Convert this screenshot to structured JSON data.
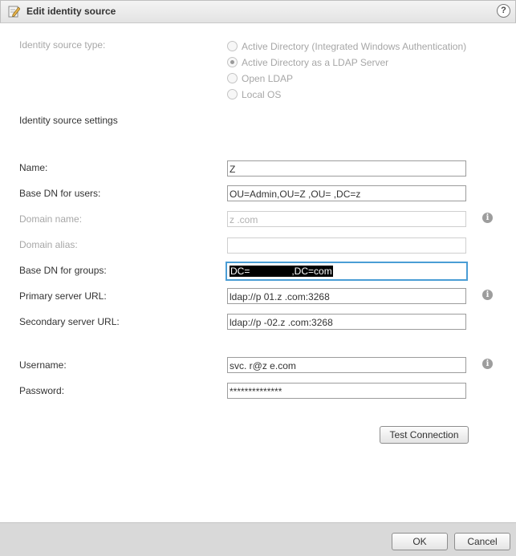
{
  "dialog": {
    "title": "Edit identity source",
    "help": "?"
  },
  "identity_type": {
    "label": "Identity source type:",
    "options": [
      {
        "label": "Active Directory (Integrated Windows Authentication)",
        "selected": false
      },
      {
        "label": "Active Directory as a LDAP Server",
        "selected": true
      },
      {
        "label": "Open LDAP",
        "selected": false
      },
      {
        "label": "Local OS",
        "selected": false
      }
    ]
  },
  "settings_heading": "Identity source settings",
  "fields": {
    "name": {
      "label": "Name:",
      "value": "Z"
    },
    "base_dn_users": {
      "label": "Base DN for users:",
      "value": "OU=Admin,OU=Z        ,OU=              ,DC=z"
    },
    "domain_name": {
      "label": "Domain name:",
      "value": "z          .com"
    },
    "domain_alias": {
      "label": "Domain alias:",
      "value": ""
    },
    "base_dn_groups": {
      "label": "Base DN for groups:",
      "value_prefix": "DC=",
      "value_suffix": ",DC=com"
    },
    "primary_url": {
      "label": "Primary server URL:",
      "value": "ldap://p            01.z              .com:3268"
    },
    "secondary_url": {
      "label": "Secondary server URL:",
      "value": "ldap://p          -02.z            .com:3268"
    },
    "username": {
      "label": "Username:",
      "value": "svc.         r@z            e.com"
    },
    "password": {
      "label": "Password:",
      "value": "**************"
    }
  },
  "buttons": {
    "test": "Test Connection",
    "ok": "OK",
    "cancel": "Cancel"
  },
  "icons": {
    "info": "i"
  }
}
